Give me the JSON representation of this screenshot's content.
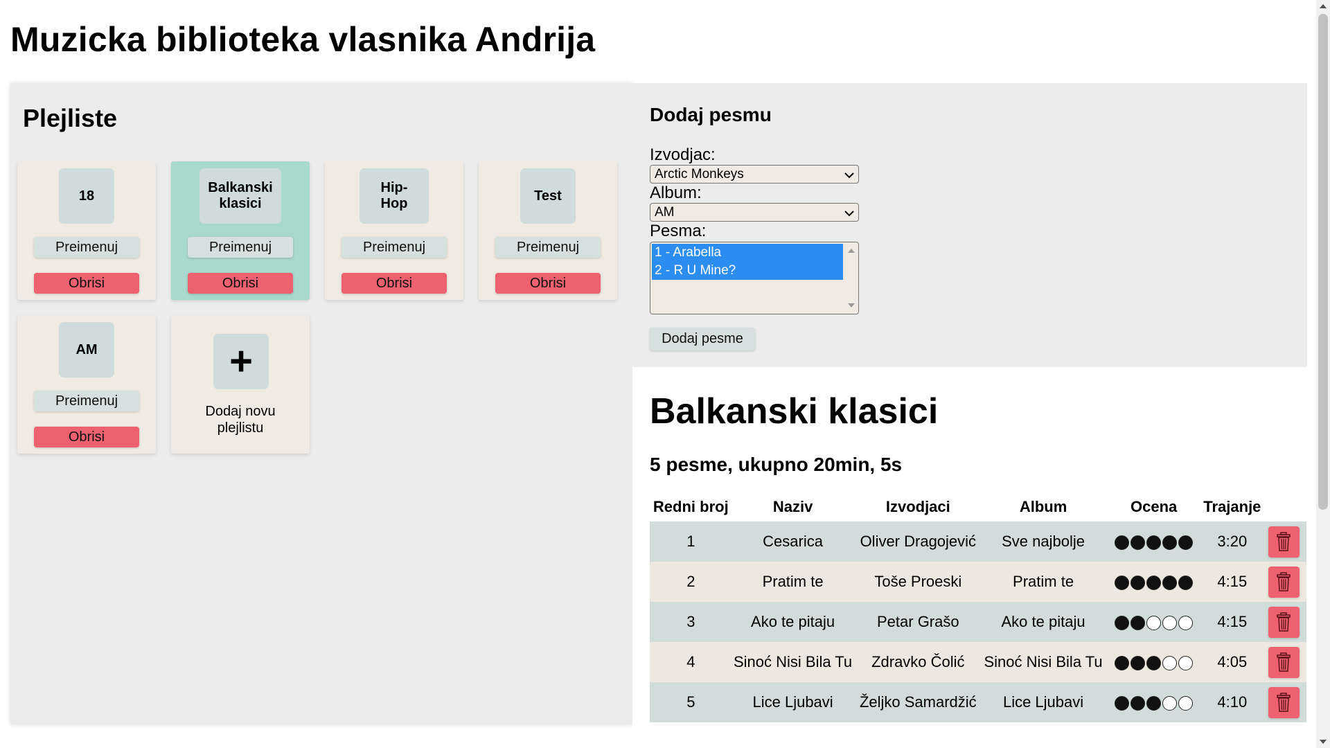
{
  "app": {
    "title": "Muzicka biblioteka vlasnika Andrija"
  },
  "playlists_panel": {
    "heading": "Plejliste",
    "rename_label": "Preimenuj",
    "delete_label": "Obrisi",
    "add_plus": "+",
    "add_label": "Dodaj novu plejlistu",
    "items": [
      {
        "name": "18",
        "selected": false
      },
      {
        "name": "Balkanski klasici",
        "selected": true
      },
      {
        "name": "Hip-Hop",
        "selected": false
      },
      {
        "name": "Test",
        "selected": false
      },
      {
        "name": "AM",
        "selected": false
      }
    ]
  },
  "add_song": {
    "heading": "Dodaj pesmu",
    "artist_label": "Izvodjac:",
    "artist_value": "Arctic Monkeys",
    "album_label": "Album:",
    "album_value": "AM",
    "song_label": "Pesma:",
    "songs": [
      "1 - Arabella",
      "2 - R U Mine?"
    ],
    "button": "Dodaj pesme"
  },
  "playlist_detail": {
    "title": "Balkanski klasici",
    "summary": "5 pesme, ukupno 20min, 5s",
    "columns": [
      "Redni broj",
      "Naziv",
      "Izvodjaci",
      "Album",
      "Ocena",
      "Trajanje"
    ],
    "rows": [
      {
        "no": "1",
        "title": "Cesarica",
        "artist": "Oliver Dragojević",
        "album": "Sve najbolje",
        "rating": 5,
        "duration": "3:20"
      },
      {
        "no": "2",
        "title": "Pratim te",
        "artist": "Toše Proeski",
        "album": "Pratim te",
        "rating": 5,
        "duration": "4:15"
      },
      {
        "no": "3",
        "title": "Ako te pitaju",
        "artist": "Petar Grašo",
        "album": "Ako te pitaju",
        "rating": 2,
        "duration": "4:15"
      },
      {
        "no": "4",
        "title": "Sinoć Nisi Bila Tu",
        "artist": "Zdravko Čolić",
        "album": "Sinoć Nisi Bila Tu",
        "rating": 3,
        "duration": "4:05"
      },
      {
        "no": "5",
        "title": "Lice Ljubavi",
        "artist": "Željko Samardžić",
        "album": "Lice Ljubavi",
        "rating": 3,
        "duration": "4:10"
      }
    ],
    "rating_max": 5
  },
  "colors": {
    "selected_card": "#a9d8cc",
    "delete_red": "#ee6170",
    "list_highlight": "#2b8df0"
  }
}
